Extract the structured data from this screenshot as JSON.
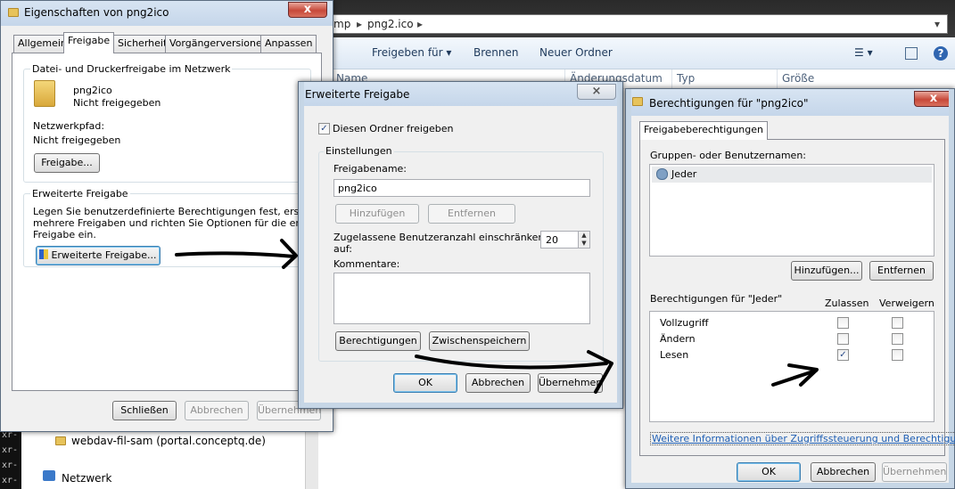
{
  "explorer": {
    "address": [
      "mp",
      "png2.ico"
    ],
    "toolbar": [
      "Freigeben für",
      "Brennen",
      "Neuer Ordner"
    ],
    "columns": [
      "Name",
      "Änderungsdatum",
      "Typ",
      "Größe"
    ],
    "nav": [
      "webdav-fil-sam (portal.conceptq.de)",
      "Netzwerk"
    ],
    "terminal": [
      "xr-",
      "xr-",
      "xr-",
      "xr-"
    ]
  },
  "props": {
    "title": "Eigenschaften von png2ico",
    "close": "x",
    "tabs": [
      "Allgemein",
      "Freigabe",
      "Sicherheit",
      "Vorgängerversionen",
      "Anpassen"
    ],
    "section1": "Datei- und Druckerfreigabe im Netzwerk",
    "item_name": "png2ico",
    "item_status": "Nicht freigegeben",
    "path_label": "Netzwerkpfad:",
    "path_value": "Nicht freigegeben",
    "share_button": "Freigabe...",
    "section2": "Erweiterte Freigabe",
    "section2_text": [
      "Legen Sie benutzerdefinierte Berechtigungen fest, erstellen Sie",
      "mehrere Freigaben und richten Sie Optionen für die erweiterte",
      "Freigabe ein."
    ],
    "adv_button": "Erweiterte Freigabe...",
    "buttons": [
      "Schließen",
      "Abbrechen",
      "Übernehmen"
    ]
  },
  "adv": {
    "title": "Erweiterte Freigabe",
    "share_checkbox": "Diesen Ordner freigeben",
    "share_checked": true,
    "settings_label": "Einstellungen",
    "sharename_label": "Freigabename:",
    "sharename_value": "png2ico",
    "add_button": "Hinzufügen",
    "remove_button": "Entfernen",
    "limit_label": [
      "Zugelassene Benutzeranzahl einschränken",
      "auf:"
    ],
    "limit_value": "20",
    "comment_label": "Kommentare:",
    "perm_button": "Berechtigungen",
    "cache_button": "Zwischenspeichern",
    "buttons": [
      "OK",
      "Abbrechen",
      "Übernehmen"
    ]
  },
  "perm": {
    "title": "Berechtigungen für \"png2ico\"",
    "close": "x",
    "tab": "Freigabeberechtigungen",
    "groups_label": "Gruppen- oder Benutzernamen:",
    "users": [
      "Jeder"
    ],
    "add_button": "Hinzufügen...",
    "remove_button": "Entfernen",
    "perm_for": "Berechtigungen für \"Jeder\"",
    "allow_header": "Zulassen",
    "deny_header": "Verweigern",
    "rows": [
      {
        "name": "Vollzugriff",
        "allow": false,
        "deny": false
      },
      {
        "name": "Ändern",
        "allow": false,
        "deny": false
      },
      {
        "name": "Lesen",
        "allow": true,
        "deny": false
      }
    ],
    "link": "Weitere Informationen über Zugriffssteuerung und Berechtigungen",
    "buttons": [
      "OK",
      "Abbrechen",
      "Übernehmen"
    ]
  },
  "colors": {
    "accent": "#3c7fb1",
    "arrow": "#000000"
  }
}
